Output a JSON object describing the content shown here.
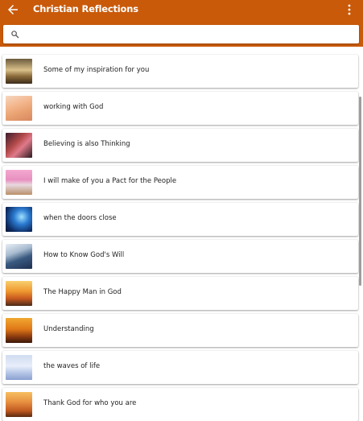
{
  "appbar": {
    "title": "Christian Reflections",
    "back_icon": "arrow-back-icon",
    "menu_icon": "more-vert-icon",
    "color": "#c95a0a"
  },
  "search": {
    "icon": "search-icon",
    "value": "",
    "placeholder": ""
  },
  "list": {
    "items": [
      {
        "label": "Some of my inspiration for you"
      },
      {
        "label": "working with God"
      },
      {
        "label": "Believing is also Thinking"
      },
      {
        "label": "I will make of you a Pact for the People"
      },
      {
        "label": "when the doors close"
      },
      {
        "label": "How to Know God's Will"
      },
      {
        "label": "The Happy Man in God"
      },
      {
        "label": "Understanding"
      },
      {
        "label": "the waves of life"
      },
      {
        "label": "Thank God for who you are"
      }
    ]
  }
}
